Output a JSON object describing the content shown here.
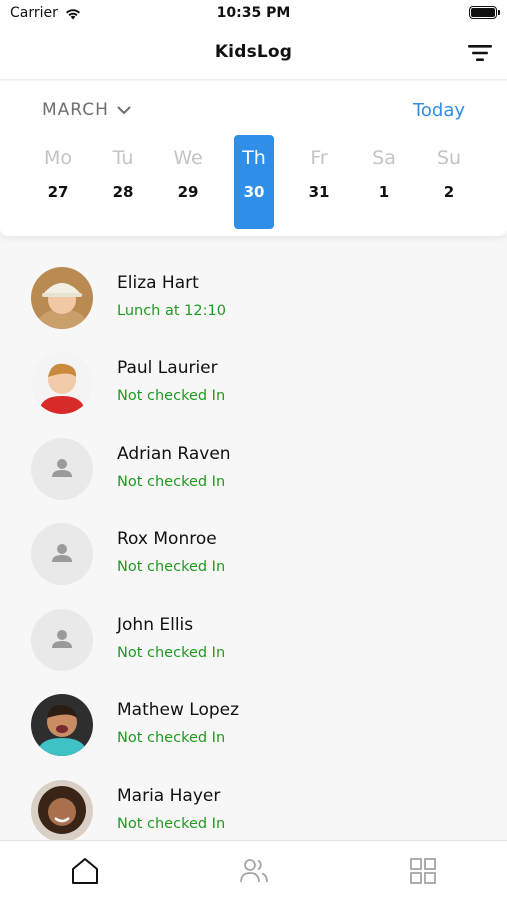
{
  "status_bar": {
    "carrier": "Carrier",
    "time": "10:35 PM"
  },
  "nav": {
    "title": "KidsLog"
  },
  "calendar": {
    "month": "MARCH",
    "today_label": "Today",
    "days": [
      {
        "dow": "Mo",
        "num": "27"
      },
      {
        "dow": "Tu",
        "num": "28"
      },
      {
        "dow": "We",
        "num": "29"
      },
      {
        "dow": "Th",
        "num": "30"
      },
      {
        "dow": "Fr",
        "num": "31"
      },
      {
        "dow": "Sa",
        "num": "1"
      },
      {
        "dow": "Su",
        "num": "2"
      }
    ],
    "selected_index": 3
  },
  "kids": [
    {
      "name": "Eliza Hart",
      "status": "Lunch at 12:10"
    },
    {
      "name": "Paul Laurier",
      "status": "Not checked In"
    },
    {
      "name": "Adrian Raven",
      "status": "Not checked In"
    },
    {
      "name": "Rox Monroe",
      "status": "Not checked In"
    },
    {
      "name": "John Ellis",
      "status": "Not checked In"
    },
    {
      "name": "Mathew Lopez",
      "status": "Not checked In"
    },
    {
      "name": "Maria Hayer",
      "status": "Not checked In"
    }
  ],
  "tabs": [
    {
      "icon": "home-icon"
    },
    {
      "icon": "people-icon"
    },
    {
      "icon": "grid-icon"
    }
  ],
  "colors": {
    "accent": "#2f8fe8",
    "status_green": "#1f9a1f"
  }
}
